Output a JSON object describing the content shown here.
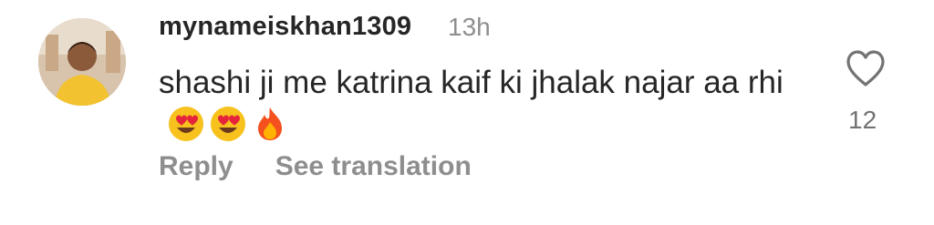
{
  "comment": {
    "username": "mynameiskhan1309",
    "time": "13h",
    "text": "shashi ji me katrina kaif ki jhalak najar aa rhi",
    "emojis": [
      "heart-eyes-emoji",
      "heart-eyes-emoji",
      "fire-emoji"
    ],
    "like_count": "12",
    "icons": {
      "like": "heart-outline-icon"
    }
  },
  "actions": {
    "reply_label": "Reply",
    "translate_label": "See translation"
  },
  "colors": {
    "text": "#262626",
    "muted": "#8e8e8e",
    "background": "#ffffff"
  }
}
